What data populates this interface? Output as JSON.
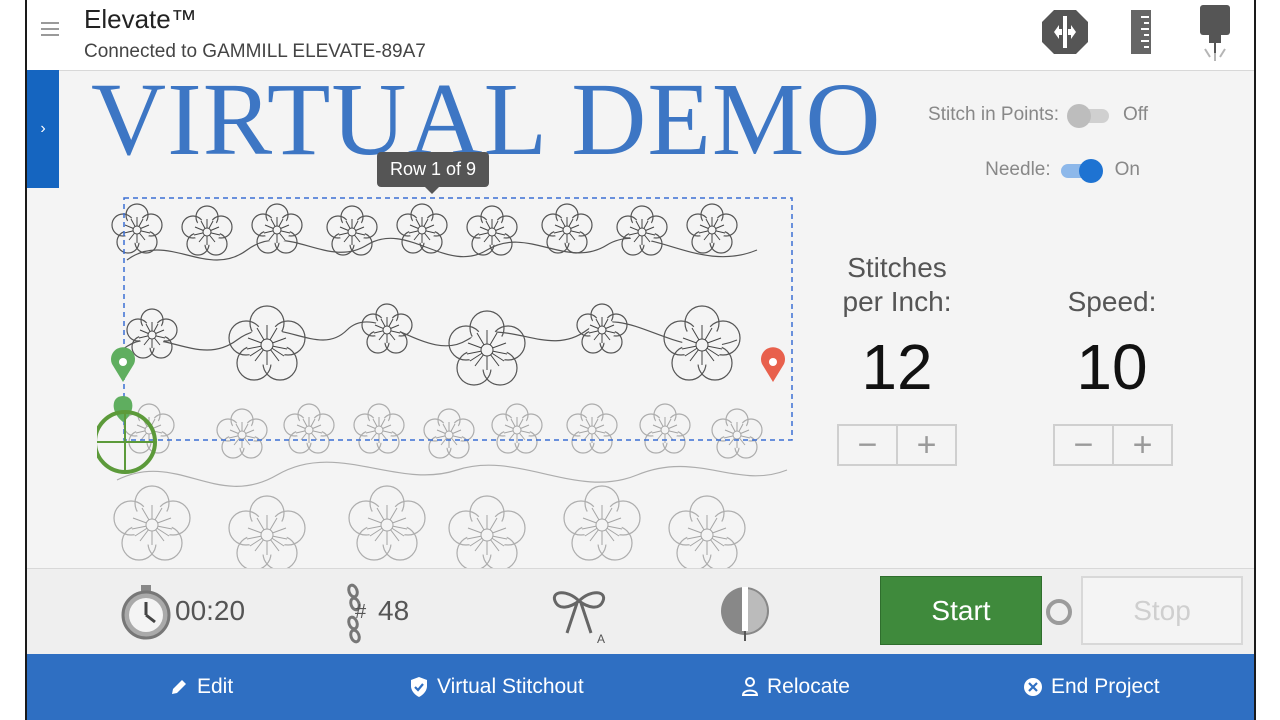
{
  "header": {
    "title": "Elevate™",
    "subtitle": "Connected to GAMMILL ELEVATE-89A7",
    "icons": [
      "needle-position-icon",
      "ruler-icon",
      "machine-head-icon"
    ]
  },
  "watermark": "VIRTUAL DEMO",
  "side_tab": {
    "glyph": "›"
  },
  "toggles": {
    "stitch_in_points": {
      "label": "Stitch in Points:",
      "state": "Off"
    },
    "needle": {
      "label": "Needle:",
      "state": "On"
    }
  },
  "row_indicator": "Row 1 of 9",
  "stitches": {
    "label_line1": "Stitches",
    "label_line2": "per Inch:",
    "value": "12",
    "minus": "−",
    "plus": "+"
  },
  "speed": {
    "label": "Speed:",
    "value": "10",
    "minus": "−",
    "plus": "+"
  },
  "status": {
    "timer": "00:20",
    "stitch_count_symbol": "#",
    "stitch_count": "48"
  },
  "buttons": {
    "start": "Start",
    "stop": "Stop"
  },
  "nav": [
    {
      "label": "Edit",
      "icon": "pencil-icon"
    },
    {
      "label": "Virtual Stitchout",
      "icon": "shield-check-icon"
    },
    {
      "label": "Relocate",
      "icon": "person-icon"
    },
    {
      "label": "End Project",
      "icon": "close-circle-icon"
    }
  ],
  "colors": {
    "accent": "#2f6fc2",
    "start": "#3f8a3c",
    "start_marker": "#5fae5f",
    "end_marker": "#e8604c",
    "watermark": "#3d76c4"
  }
}
